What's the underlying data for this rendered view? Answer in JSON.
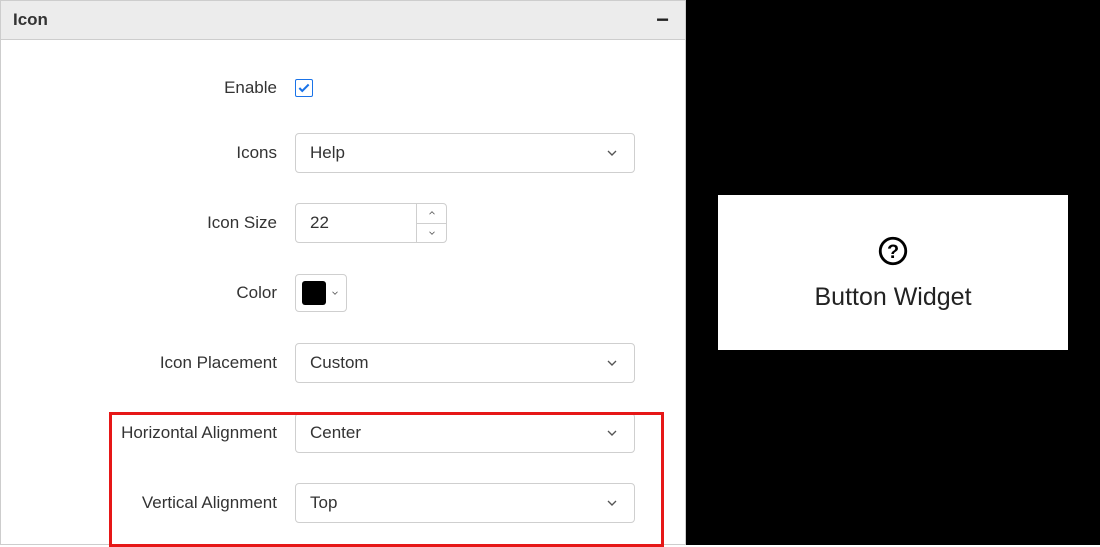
{
  "panel": {
    "title": "Icon"
  },
  "form": {
    "enable_label": "Enable",
    "enable_value": true,
    "icons_label": "Icons",
    "icons_value": "Help",
    "icon_size_label": "Icon Size",
    "icon_size_value": "22",
    "color_label": "Color",
    "color_value": "#000000",
    "placement_label": "Icon Placement",
    "placement_value": "Custom",
    "halign_label": "Horizontal Alignment",
    "halign_value": "Center",
    "valign_label": "Vertical Alignment",
    "valign_value": "Top"
  },
  "preview": {
    "button_label": "Button Widget"
  }
}
